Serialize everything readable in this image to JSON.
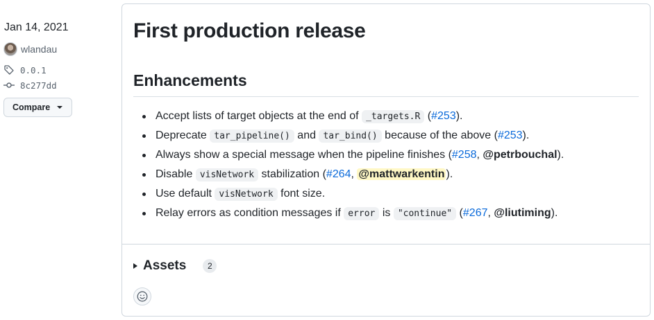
{
  "sidebar": {
    "date": "Jan 14, 2021",
    "author": "wlandau",
    "tag": "0.0.1",
    "commit": "8c277dd",
    "compare_label": "Compare"
  },
  "release": {
    "title": "First production release",
    "section_heading": "Enhancements",
    "notes": [
      {
        "t1": "Accept lists of target objects at the end of ",
        "c1": "_targets.R",
        "t2": " (",
        "l1": "#253",
        "t3": ")."
      },
      {
        "t1": "Deprecate ",
        "c1": "tar_pipeline()",
        "t2": " and ",
        "c2": "tar_bind()",
        "t3": " because of the above (",
        "l1": "#253",
        "t4": ")."
      },
      {
        "t1": "Always show a special message when the pipeline finishes (",
        "l1": "#258",
        "t2": ", ",
        "m1": "@petrbouchal",
        "t3": ")."
      },
      {
        "t1": "Disable ",
        "c1": "visNetwork",
        "t2": " stabilization (",
        "l1": "#264",
        "t3": ", ",
        "m1": "@mattwarkentin",
        "t4": ")."
      },
      {
        "t1": "Use default ",
        "c1": "visNetwork",
        "t2": " font size."
      },
      {
        "t1": "Relay errors as condition messages if ",
        "c1": "error",
        "t2": " is ",
        "c2": "\"continue\"",
        "t3": " (",
        "l1": "#267",
        "t4": ", ",
        "m1": "@liutiming",
        "t5": ")."
      }
    ],
    "assets_label": "Assets",
    "assets_count": "2"
  },
  "icons": [
    "tag-icon",
    "commit-icon",
    "smiley-icon",
    "caret-down-icon",
    "disclosure-triangle-icon"
  ],
  "colors": {
    "link": "#0969da",
    "mention_highlight": "#fff8c5",
    "border": "#d0d7de"
  }
}
